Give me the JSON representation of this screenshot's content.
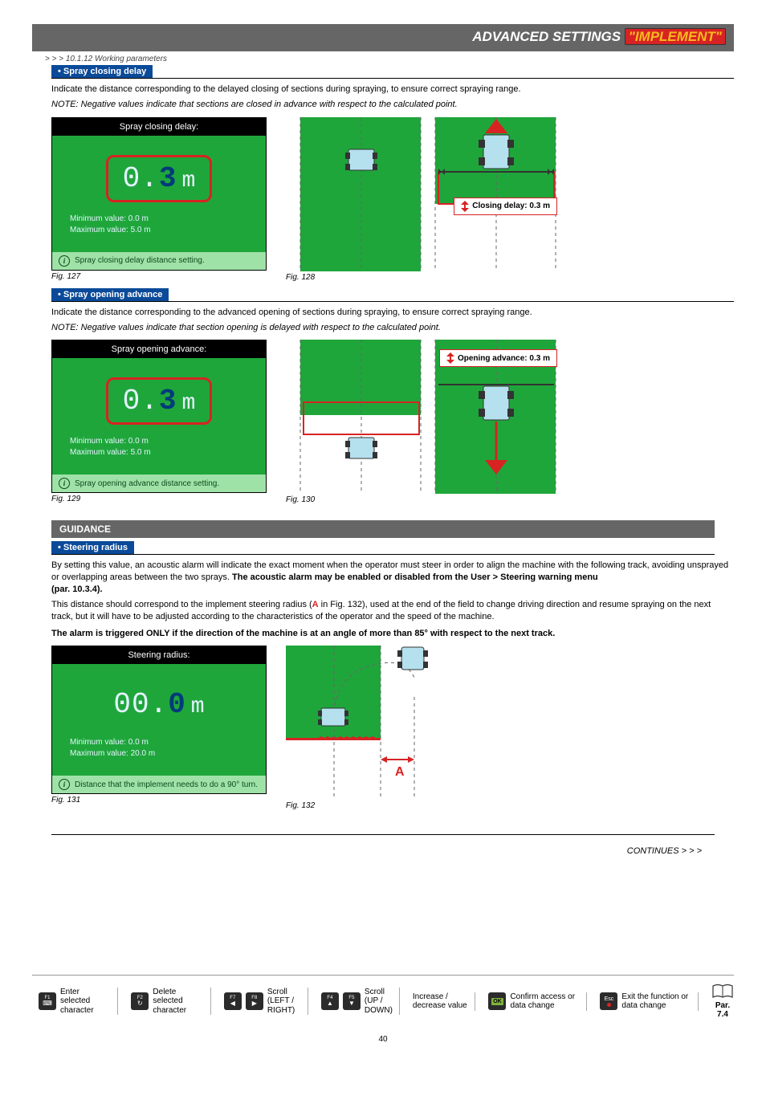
{
  "header": {
    "title_plain": "ADVANCED SETTINGS ",
    "title_hl": "\"IMPLEMENT\""
  },
  "breadcrumb": "> > > 10.1.12 Working parameters",
  "sec1": {
    "tag": "• Spray closing delay",
    "desc": "Indicate the distance corresponding to the delayed closing of sections during spraying, to ensure correct spraying range.",
    "note": "NOTE: Negative values indicate that sections are closed in advance with respect to the calculated point.",
    "device": {
      "title": "Spray closing delay:",
      "value_leading": "0.",
      "value_hot": "3",
      "unit": "m",
      "min": "Minimum value:  0.0 m",
      "max": "Maximum value:  5.0 m",
      "info": "Spray closing delay distance setting."
    },
    "fig_a": "Fig. 127",
    "fig_b": "Fig. 128",
    "badge": "Closing delay: 0.3 m"
  },
  "sec2": {
    "tag": "• Spray opening advance",
    "desc": "Indicate the distance corresponding to the advanced opening of sections during spraying, to ensure correct spraying range.",
    "note": "NOTE: Negative values indicate that section opening is delayed with respect to the calculated point.",
    "device": {
      "title": "Spray opening advance:",
      "value_leading": "0.",
      "value_hot": "3",
      "unit": "m",
      "min": "Minimum value:  0.0 m",
      "max": "Maximum value:  5.0 m",
      "info": "Spray opening advance distance setting."
    },
    "fig_a": "Fig. 129",
    "fig_b": "Fig. 130",
    "badge": "Opening advance: 0.3 m"
  },
  "guidance": {
    "header": "GUIDANCE",
    "tag": "• Steering radius",
    "p1a": "By setting this value, an acoustic alarm will indicate the exact moment when the operator must steer in order to align the machine with the following track, avoiding unsprayed or overlapping areas between the two sprays. ",
    "p1b_bold": "The acoustic alarm may be enabled or disabled from the ",
    "p1b_menu": "User > Steering warning",
    "p1b_menu2": " menu ",
    "p1c_bold": "(par. 10.3.4).",
    "p2a": "This distance should correspond to the implement steering radius (",
    "p2b_A": "A",
    "p2c": " in Fig. 132), used at the end of the field to change driving direction and resume spraying on the next track, but it will have to be adjusted according to the characteristics of the operator and the speed of the machine.",
    "p3": "The alarm is triggered ONLY if the direction of the machine is at an angle of more than 85° with respect to the next track.",
    "device": {
      "title": "Steering radius:",
      "value_leading": "00.",
      "value_hot": "0",
      "unit": "m",
      "min": "Minimum value:  0.0 m",
      "max": "Maximum value:  20.0 m",
      "info": "Distance that the implement needs to do a 90° turn."
    },
    "fig_a": "Fig. 131",
    "fig_b": "Fig. 132",
    "marker": "A"
  },
  "continues": "CONTINUES > > >",
  "footer": {
    "f1": {
      "key": "F1",
      "text": "Enter selected character"
    },
    "f2": {
      "key": "F2",
      "text": "Delete selected character"
    },
    "f7": "F7",
    "f8": "F8",
    "scroll_lr": "Scroll",
    "scroll_lr2": "(LEFT / RIGHT)",
    "f4": "F4",
    "f5": "F5",
    "scroll_ud": "Scroll",
    "scroll_ud2": "(UP / DOWN)",
    "incdec": "Increase / decrease value",
    "ok": "OK",
    "ok_text": "Confirm access or data change",
    "esc": "Esc",
    "esc_text": "Exit the function or data change",
    "par": "Par.",
    "par_num": "7.4"
  },
  "page_number": "40"
}
